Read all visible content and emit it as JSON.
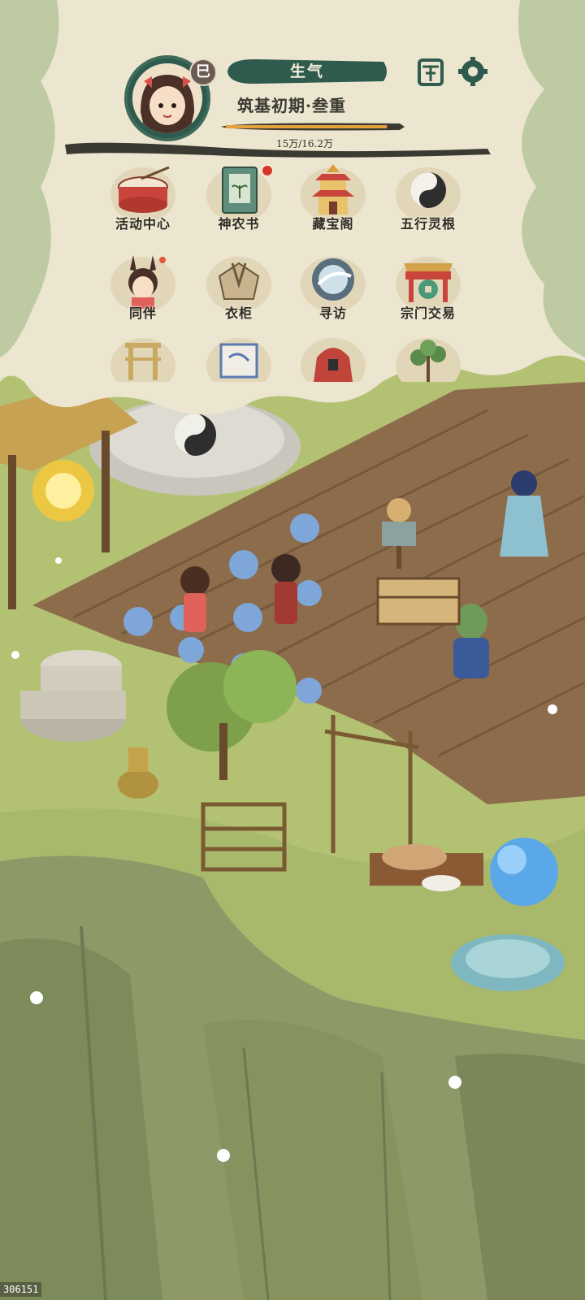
{
  "player": {
    "badge": "巳",
    "title": "生气",
    "realm": "筑基初期·叁重",
    "exp_text": "15万/16.2万",
    "exp_progress": 0.926
  },
  "top_icons": [
    {
      "name": "pavilion-icon"
    },
    {
      "name": "gear-icon"
    }
  ],
  "menu": {
    "row1": [
      "活动中心",
      "神农书",
      "藏宝阁",
      "五行灵根"
    ],
    "row2": [
      "同伴",
      "衣柜",
      "寻访",
      "宗门交易"
    ]
  },
  "footer": {
    "id": "306151"
  },
  "colors": {
    "paper": "#ece5cf",
    "ink": "#2f5a4e",
    "grass": "#a9b96c",
    "soil": "#8a6a4a",
    "cliff": "#8f9a68",
    "exp_gold": "#e3a23a"
  }
}
